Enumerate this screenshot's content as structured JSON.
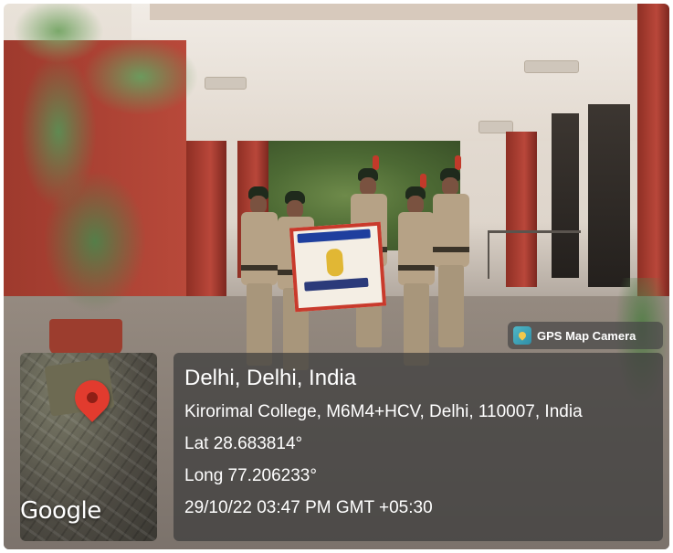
{
  "overlay": {
    "app_badge": {
      "label": "GPS Map Camera",
      "icon": "gps-map-camera-icon"
    },
    "map": {
      "credit": "Google",
      "pin_color": "#e23b2e"
    },
    "location": {
      "title": "Delhi, Delhi, India",
      "address": "Kirorimal College, M6M4+HCV, Delhi, 110007, India",
      "latitude": "Lat 28.683814°",
      "longitude": "Long 77.206233°",
      "datetime": "29/10/22 03:47 PM GMT +05:30"
    }
  }
}
